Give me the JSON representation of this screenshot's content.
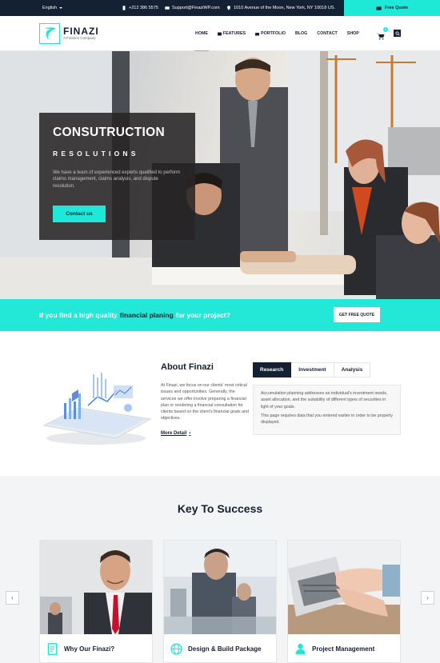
{
  "topbar": {
    "language": "English",
    "phone": "+212 386 5575",
    "email": "Support@FinaziWP.com",
    "address": "1010 Avenue of the Moon, New York, NY 10018 US.",
    "quote_label": "Free Quote"
  },
  "header": {
    "logo_name": "FINAZI",
    "logo_tagline": "A Finance Company",
    "nav": [
      {
        "label": "HOME",
        "active": true
      },
      {
        "label": "FEATURES",
        "icon": "grid-icon"
      },
      {
        "label": "PORTFOLIO",
        "icon": "briefcase-icon"
      },
      {
        "label": "BLOG"
      },
      {
        "label": "CONTACT"
      },
      {
        "label": "SHOP"
      }
    ],
    "cart_count": "0"
  },
  "hero": {
    "title": "CONSUTRUCTION",
    "subtitle": "RESOLUTIONS",
    "description": "We have a team of experienced experts qualified to perform claims management, claims analysis, and dispute resolution.",
    "button_label": "Contact us"
  },
  "cta": {
    "text_before": "If you find a high quality",
    "text_highlight": "financial planing",
    "text_after": "for your project?",
    "button_label": "GET FREE QUOTE"
  },
  "about": {
    "title": "About Finazi",
    "text": "At Finazi, we focus on our clients' most critical issues and opportunities. Generally, the services we offer involve preparing a financial plan or rendering a financial consultation for clients based on the client's financial goals and objectives.",
    "more_label": "More Detail",
    "tabs": [
      {
        "label": "Research",
        "active": true
      },
      {
        "label": "Investment"
      },
      {
        "label": "Analysis"
      }
    ],
    "tab_paragraph_1": "Accumulation planning addresses an individual's investment needs, asset allocation, and the suitability of different types of securities in light of your goals.",
    "tab_paragraph_2": "This page requires data that you entered earlier in order to be properly displayed."
  },
  "key_to_success": {
    "title": "Key To Success",
    "cards": [
      {
        "label": "Why Our Finazi?",
        "icon": "document-icon"
      },
      {
        "label": "Design & Build Package",
        "icon": "globe-icon"
      },
      {
        "label": "Project Management",
        "icon": "user-icon"
      }
    ],
    "prev_arrow": "‹",
    "next_arrow": "›"
  },
  "colors": {
    "accent": "#1ee8d8",
    "navy": "#142033"
  }
}
